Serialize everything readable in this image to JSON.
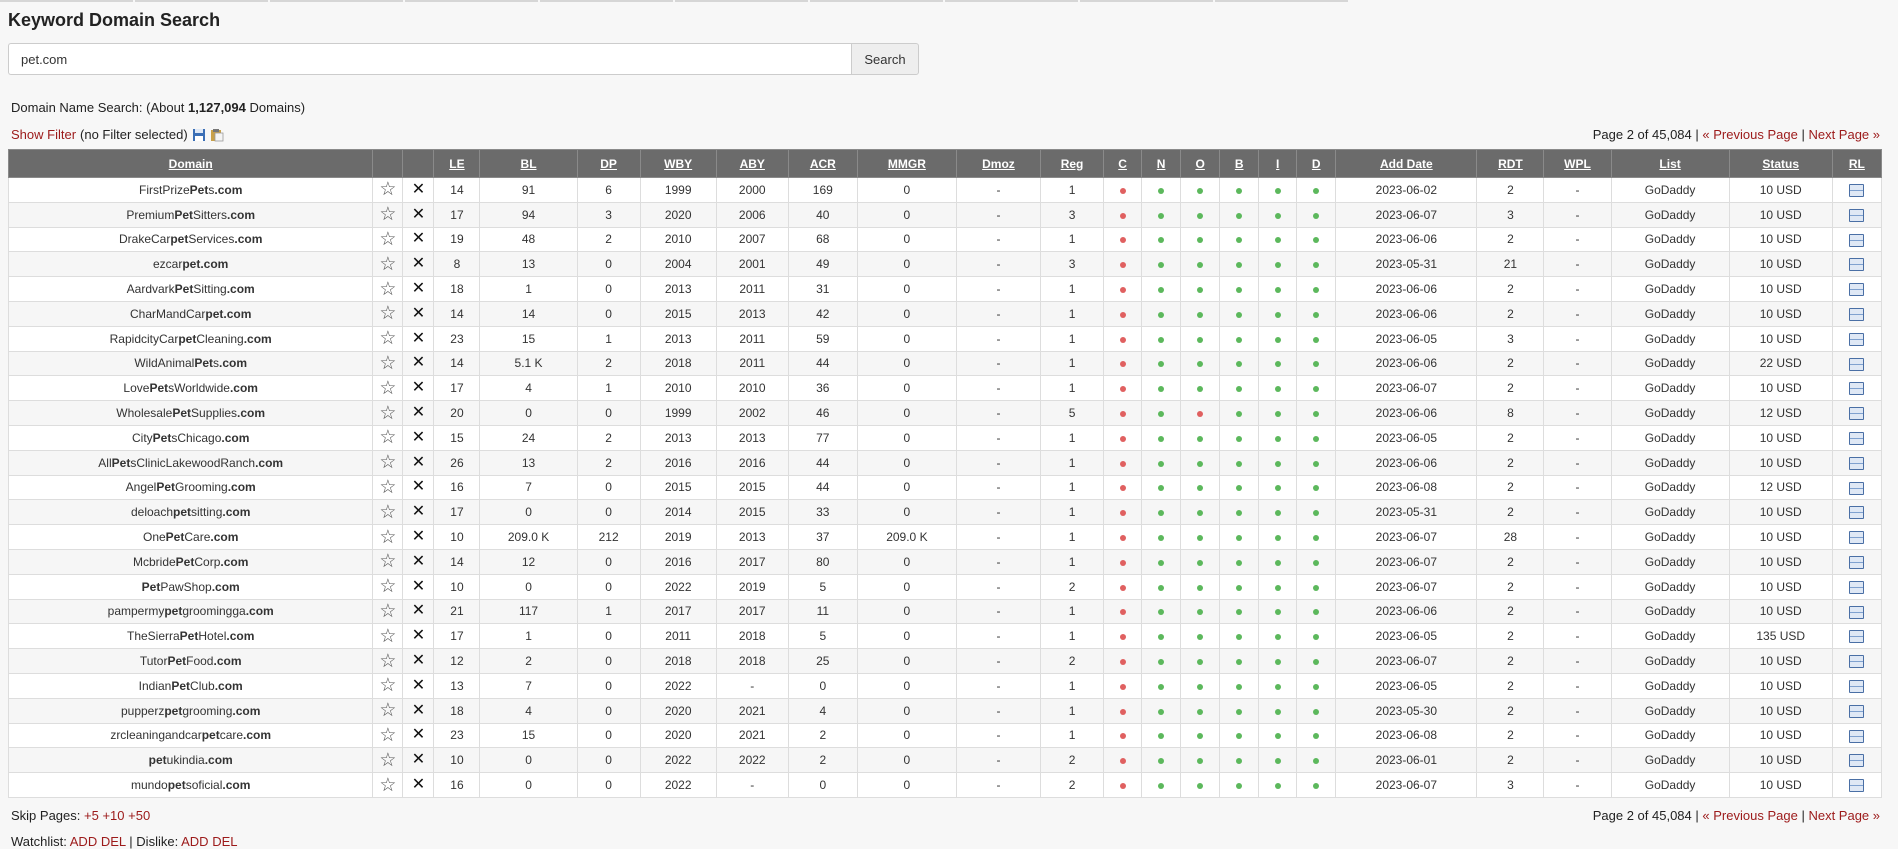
{
  "page": {
    "title": "Keyword Domain Search",
    "search": {
      "value": "pet.com",
      "button": "Search"
    },
    "summary": {
      "prefix": "Domain Name Search: (About ",
      "count": "1,127,094",
      "suffix": " Domains)"
    },
    "filter": {
      "link": "Show Filter",
      "note": "(no Filter selected)"
    },
    "pager": {
      "page_info": "Page 2 of 45,084",
      "sep": "|",
      "prev": "« Previous Page",
      "next": "Next Page »"
    },
    "skip": {
      "label": "Skip Pages:",
      "p5": "+5",
      "p10": "+10",
      "p50": "+50"
    },
    "watch": {
      "watch_label": "Watchlist:",
      "add": "ADD",
      "del": "DEL",
      "sep": "|",
      "dislike_label": "Dislike:",
      "add2": "ADD",
      "del2": "DEL"
    }
  },
  "table": {
    "headers": {
      "domain": "Domain",
      "le": "LE",
      "bl": "BL",
      "dp": "DP",
      "wby": "WBY",
      "aby": "ABY",
      "acr": "ACR",
      "mmgr": "MMGR",
      "dmoz": "Dmoz",
      "reg": "Reg",
      "c": "C",
      "n": "N",
      "o": "O",
      "b": "B",
      "i": "I",
      "d": "D",
      "add": "Add Date",
      "rdt": "RDT",
      "wpl": "WPL",
      "list": "List",
      "status": "Status",
      "rl": "RL"
    },
    "rows": [
      {
        "dom": [
          "FirstPrize",
          "Pet",
          "s",
          ".com"
        ],
        "le": "14",
        "bl": "91",
        "dp": "6",
        "wby": "1999",
        "aby": "2000",
        "acr": "169",
        "mmgr": "0",
        "dmoz": "-",
        "reg": "1",
        "dots": "rggggg",
        "add": "2023-06-02",
        "rdt": "2",
        "wpl": "-",
        "list": "GoDaddy",
        "status": "10 USD"
      },
      {
        "dom": [
          "Premium",
          "Pet",
          "Sitters",
          ".com"
        ],
        "le": "17",
        "bl": "94",
        "dp": "3",
        "wby": "2020",
        "aby": "2006",
        "acr": "40",
        "mmgr": "0",
        "dmoz": "-",
        "reg": "3",
        "dots": "rggggg",
        "add": "2023-06-07",
        "rdt": "3",
        "wpl": "-",
        "list": "GoDaddy",
        "status": "10 USD"
      },
      {
        "dom": [
          "DrakeCar",
          "pet",
          "Services",
          ".com"
        ],
        "le": "19",
        "bl": "48",
        "dp": "2",
        "wby": "2010",
        "aby": "2007",
        "acr": "68",
        "mmgr": "0",
        "dmoz": "-",
        "reg": "1",
        "dots": "rggggg",
        "add": "2023-06-06",
        "rdt": "2",
        "wpl": "-",
        "list": "GoDaddy",
        "status": "10 USD"
      },
      {
        "dom": [
          "ezcar",
          "pet",
          "",
          ".com"
        ],
        "le": "8",
        "bl": "13",
        "dp": "0",
        "wby": "2004",
        "aby": "2001",
        "acr": "49",
        "mmgr": "0",
        "dmoz": "-",
        "reg": "3",
        "dots": "rggggg",
        "add": "2023-05-31",
        "rdt": "21",
        "wpl": "-",
        "list": "GoDaddy",
        "status": "10 USD"
      },
      {
        "dom": [
          "Aardvark",
          "Pet",
          "Sitting",
          ".com"
        ],
        "le": "18",
        "bl": "1",
        "dp": "0",
        "wby": "2013",
        "aby": "2011",
        "acr": "31",
        "mmgr": "0",
        "dmoz": "-",
        "reg": "1",
        "dots": "rggggg",
        "add": "2023-06-06",
        "rdt": "2",
        "wpl": "-",
        "list": "GoDaddy",
        "status": "10 USD"
      },
      {
        "dom": [
          "CharMandCar",
          "pet",
          "",
          ".com"
        ],
        "le": "14",
        "bl": "14",
        "dp": "0",
        "wby": "2015",
        "aby": "2013",
        "acr": "42",
        "mmgr": "0",
        "dmoz": "-",
        "reg": "1",
        "dots": "rggggg",
        "add": "2023-06-06",
        "rdt": "2",
        "wpl": "-",
        "list": "GoDaddy",
        "status": "10 USD"
      },
      {
        "dom": [
          "RapidcityCar",
          "pet",
          "Cleaning",
          ".com"
        ],
        "le": "23",
        "bl": "15",
        "dp": "1",
        "wby": "2013",
        "aby": "2011",
        "acr": "59",
        "mmgr": "0",
        "dmoz": "-",
        "reg": "1",
        "dots": "rggggg",
        "add": "2023-06-05",
        "rdt": "3",
        "wpl": "-",
        "list": "GoDaddy",
        "status": "10 USD"
      },
      {
        "dom": [
          "WildAnimal",
          "Pet",
          "s",
          ".com"
        ],
        "le": "14",
        "bl": "5.1 K",
        "dp": "2",
        "wby": "2018",
        "aby": "2011",
        "acr": "44",
        "mmgr": "0",
        "dmoz": "-",
        "reg": "1",
        "dots": "rggggg",
        "add": "2023-06-06",
        "rdt": "2",
        "wpl": "-",
        "list": "GoDaddy",
        "status": "22 USD"
      },
      {
        "dom": [
          "Love",
          "Pet",
          "sWorldwide",
          ".com"
        ],
        "le": "17",
        "bl": "4",
        "dp": "1",
        "wby": "2010",
        "aby": "2010",
        "acr": "36",
        "mmgr": "0",
        "dmoz": "-",
        "reg": "1",
        "dots": "rggggg",
        "add": "2023-06-07",
        "rdt": "2",
        "wpl": "-",
        "list": "GoDaddy",
        "status": "10 USD"
      },
      {
        "dom": [
          "Wholesale",
          "Pet",
          "Supplies",
          ".com"
        ],
        "le": "20",
        "bl": "0",
        "dp": "0",
        "wby": "1999",
        "aby": "2002",
        "acr": "46",
        "mmgr": "0",
        "dmoz": "-",
        "reg": "5",
        "dots": "rgrggg",
        "add": "2023-06-06",
        "rdt": "8",
        "wpl": "-",
        "list": "GoDaddy",
        "status": "12 USD"
      },
      {
        "dom": [
          "City",
          "Pet",
          "sChicago",
          ".com"
        ],
        "le": "15",
        "bl": "24",
        "dp": "2",
        "wby": "2013",
        "aby": "2013",
        "acr": "77",
        "mmgr": "0",
        "dmoz": "-",
        "reg": "1",
        "dots": "rggggg",
        "add": "2023-06-05",
        "rdt": "2",
        "wpl": "-",
        "list": "GoDaddy",
        "status": "10 USD"
      },
      {
        "dom": [
          "All",
          "Pet",
          "sClinicLakewoodRanch",
          ".com"
        ],
        "le": "26",
        "bl": "13",
        "dp": "2",
        "wby": "2016",
        "aby": "2016",
        "acr": "44",
        "mmgr": "0",
        "dmoz": "-",
        "reg": "1",
        "dots": "rggggg",
        "add": "2023-06-06",
        "rdt": "2",
        "wpl": "-",
        "list": "GoDaddy",
        "status": "10 USD"
      },
      {
        "dom": [
          "Angel",
          "Pet",
          "Grooming",
          ".com"
        ],
        "le": "16",
        "bl": "7",
        "dp": "0",
        "wby": "2015",
        "aby": "2015",
        "acr": "44",
        "mmgr": "0",
        "dmoz": "-",
        "reg": "1",
        "dots": "rggggg",
        "add": "2023-06-08",
        "rdt": "2",
        "wpl": "-",
        "list": "GoDaddy",
        "status": "12 USD"
      },
      {
        "dom": [
          "deloach",
          "pet",
          "sitting",
          ".com"
        ],
        "le": "17",
        "bl": "0",
        "dp": "0",
        "wby": "2014",
        "aby": "2015",
        "acr": "33",
        "mmgr": "0",
        "dmoz": "-",
        "reg": "1",
        "dots": "rggggg",
        "add": "2023-05-31",
        "rdt": "2",
        "wpl": "-",
        "list": "GoDaddy",
        "status": "10 USD"
      },
      {
        "dom": [
          "One",
          "Pet",
          "Care",
          ".com"
        ],
        "le": "10",
        "bl": "209.0 K",
        "dp": "212",
        "wby": "2019",
        "aby": "2013",
        "acr": "37",
        "mmgr": "209.0 K",
        "dmoz": "-",
        "reg": "1",
        "dots": "rggggg",
        "add": "2023-06-07",
        "rdt": "28",
        "wpl": "-",
        "list": "GoDaddy",
        "status": "10 USD"
      },
      {
        "dom": [
          "Mcbride",
          "Pet",
          "Corp",
          ".com"
        ],
        "le": "14",
        "bl": "12",
        "dp": "0",
        "wby": "2016",
        "aby": "2017",
        "acr": "80",
        "mmgr": "0",
        "dmoz": "-",
        "reg": "1",
        "dots": "rggggg",
        "add": "2023-06-07",
        "rdt": "2",
        "wpl": "-",
        "list": "GoDaddy",
        "status": "10 USD"
      },
      {
        "dom": [
          "",
          "Pet",
          "PawShop",
          ".com"
        ],
        "le": "10",
        "bl": "0",
        "dp": "0",
        "wby": "2022",
        "aby": "2019",
        "acr": "5",
        "mmgr": "0",
        "dmoz": "-",
        "reg": "2",
        "dots": "rggggg",
        "add": "2023-06-07",
        "rdt": "2",
        "wpl": "-",
        "list": "GoDaddy",
        "status": "10 USD"
      },
      {
        "dom": [
          "pampermy",
          "pet",
          "groomingga",
          ".com"
        ],
        "le": "21",
        "bl": "117",
        "dp": "1",
        "wby": "2017",
        "aby": "2017",
        "acr": "11",
        "mmgr": "0",
        "dmoz": "-",
        "reg": "1",
        "dots": "rggggg",
        "add": "2023-06-06",
        "rdt": "2",
        "wpl": "-",
        "list": "GoDaddy",
        "status": "10 USD"
      },
      {
        "dom": [
          "TheSierra",
          "Pet",
          "Hotel",
          ".com"
        ],
        "le": "17",
        "bl": "1",
        "dp": "0",
        "wby": "2011",
        "aby": "2018",
        "acr": "5",
        "mmgr": "0",
        "dmoz": "-",
        "reg": "1",
        "dots": "rggggg",
        "add": "2023-06-05",
        "rdt": "2",
        "wpl": "-",
        "list": "GoDaddy",
        "status": "135 USD"
      },
      {
        "dom": [
          "Tutor",
          "Pet",
          "Food",
          ".com"
        ],
        "le": "12",
        "bl": "2",
        "dp": "0",
        "wby": "2018",
        "aby": "2018",
        "acr": "25",
        "mmgr": "0",
        "dmoz": "-",
        "reg": "2",
        "dots": "rggggg",
        "add": "2023-06-07",
        "rdt": "2",
        "wpl": "-",
        "list": "GoDaddy",
        "status": "10 USD"
      },
      {
        "dom": [
          "Indian",
          "Pet",
          "Club",
          ".com"
        ],
        "le": "13",
        "bl": "7",
        "dp": "0",
        "wby": "2022",
        "aby": "-",
        "acr": "0",
        "mmgr": "0",
        "dmoz": "-",
        "reg": "1",
        "dots": "rggggg",
        "add": "2023-06-05",
        "rdt": "2",
        "wpl": "-",
        "list": "GoDaddy",
        "status": "10 USD"
      },
      {
        "dom": [
          "pupperz",
          "pet",
          "grooming",
          ".com"
        ],
        "le": "18",
        "bl": "4",
        "dp": "0",
        "wby": "2020",
        "aby": "2021",
        "acr": "4",
        "mmgr": "0",
        "dmoz": "-",
        "reg": "1",
        "dots": "rggggg",
        "add": "2023-05-30",
        "rdt": "2",
        "wpl": "-",
        "list": "GoDaddy",
        "status": "10 USD"
      },
      {
        "dom": [
          "zrcleaningandcar",
          "pet",
          "care",
          ".com"
        ],
        "le": "23",
        "bl": "15",
        "dp": "0",
        "wby": "2020",
        "aby": "2021",
        "acr": "2",
        "mmgr": "0",
        "dmoz": "-",
        "reg": "1",
        "dots": "rggggg",
        "add": "2023-06-08",
        "rdt": "2",
        "wpl": "-",
        "list": "GoDaddy",
        "status": "10 USD"
      },
      {
        "dom": [
          "",
          "pet",
          "ukindia",
          ".com"
        ],
        "le": "10",
        "bl": "0",
        "dp": "0",
        "wby": "2022",
        "aby": "2022",
        "acr": "2",
        "mmgr": "0",
        "dmoz": "-",
        "reg": "2",
        "dots": "rggggg",
        "add": "2023-06-01",
        "rdt": "2",
        "wpl": "-",
        "list": "GoDaddy",
        "status": "10 USD"
      },
      {
        "dom": [
          "mundo",
          "pet",
          "soficial",
          ".com"
        ],
        "le": "16",
        "bl": "0",
        "dp": "0",
        "wby": "2022",
        "aby": "-",
        "acr": "0",
        "mmgr": "0",
        "dmoz": "-",
        "reg": "2",
        "dots": "rggggg",
        "add": "2023-06-07",
        "rdt": "3",
        "wpl": "-",
        "list": "GoDaddy",
        "status": "10 USD"
      }
    ]
  }
}
